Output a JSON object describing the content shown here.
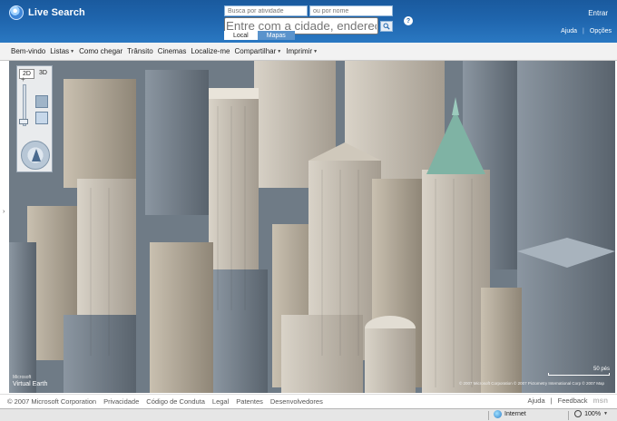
{
  "header": {
    "brand": "Live Search",
    "signin": "Entrar",
    "search_what_placeholder": "Busca por atividade",
    "search_name_placeholder": "ou por nome",
    "search_where_placeholder": "Entre com a cidade, endereço ou cep",
    "help_symbol": "?",
    "tabs": [
      {
        "label": "Local",
        "active": true
      },
      {
        "label": "Mapas",
        "active": false
      }
    ],
    "links": {
      "help": "Ajuda",
      "sep": "|",
      "options": "Opções"
    }
  },
  "toolbar": {
    "items": [
      {
        "label": "Bem-vindo",
        "dropdown": false
      },
      {
        "label": "Listas",
        "dropdown": true
      },
      {
        "label": "Como chegar",
        "dropdown": false
      },
      {
        "label": "Trânsito",
        "dropdown": false
      },
      {
        "label": "Cinemas",
        "dropdown": false
      },
      {
        "label": "Localize-me",
        "dropdown": false
      },
      {
        "label": "Compartilhar",
        "dropdown": true
      },
      {
        "label": "Imprimir",
        "dropdown": true
      }
    ],
    "arrow": "▼"
  },
  "map": {
    "nav": {
      "mode_2d": "2D",
      "mode_3d": "3D",
      "zoom_plus": "+"
    },
    "side_handle": "›",
    "logo_ms": "Microsoft",
    "logo_name": "Virtual Earth",
    "scale_label": "50 pés",
    "copyright": "© 2007 Microsoft Corporation  © 2007 Pictometry International Corp  © 2007 Map"
  },
  "footer": {
    "left": [
      "© 2007 Microsoft Corporation",
      "Privacidade",
      "Código de Conduta",
      "Legal",
      "Patentes",
      "Desenvolvedores"
    ],
    "right": {
      "help": "Ajuda",
      "sep": "|",
      "feedback": "Feedback",
      "brand": "msn"
    }
  },
  "statusbar": {
    "zone": "Internet",
    "zoom": "100%",
    "zoom_arrow": "▼"
  },
  "colors": {
    "header": "#1f65ad",
    "toolbar": "#f2f2f2"
  }
}
